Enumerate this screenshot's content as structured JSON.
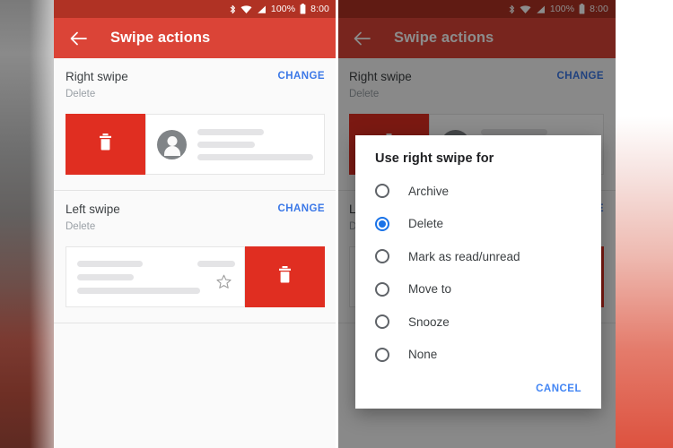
{
  "status_bar": {
    "bluetooth_icon": "bluetooth-icon",
    "wifi_icon": "wifi-icon",
    "signal_icon": "signal-icon",
    "battery_percent": "100%",
    "battery_icon": "battery-full-icon",
    "time": "8:00"
  },
  "app_bar": {
    "back_icon": "back-arrow-icon",
    "title": "Swipe actions"
  },
  "sections": [
    {
      "title": "Right swipe",
      "subtitle": "Delete",
      "change_label": "CHANGE",
      "preview": {
        "direction": "right",
        "action_icon": "trash-icon",
        "action_color": "#e02e21",
        "avatar_icon": "person-avatar-icon"
      }
    },
    {
      "title": "Left swipe",
      "subtitle": "Delete",
      "change_label": "CHANGE",
      "preview": {
        "direction": "left",
        "action_icon": "trash-icon",
        "action_color": "#e02e21",
        "star_icon": "star-outline-icon"
      }
    }
  ],
  "dialog": {
    "title": "Use right swipe for",
    "options": [
      {
        "label": "Archive",
        "selected": false
      },
      {
        "label": "Delete",
        "selected": true
      },
      {
        "label": "Mark as read/unread",
        "selected": false
      },
      {
        "label": "Move to",
        "selected": false
      },
      {
        "label": "Snooze",
        "selected": false
      },
      {
        "label": "None",
        "selected": false
      }
    ],
    "cancel_label": "CANCEL"
  },
  "colors": {
    "app_bar": "#db4437",
    "status_bar": "#b03224",
    "accent_link": "#3b78e7",
    "radio_selected": "#1a73e8",
    "swipe_action": "#e02e21"
  }
}
